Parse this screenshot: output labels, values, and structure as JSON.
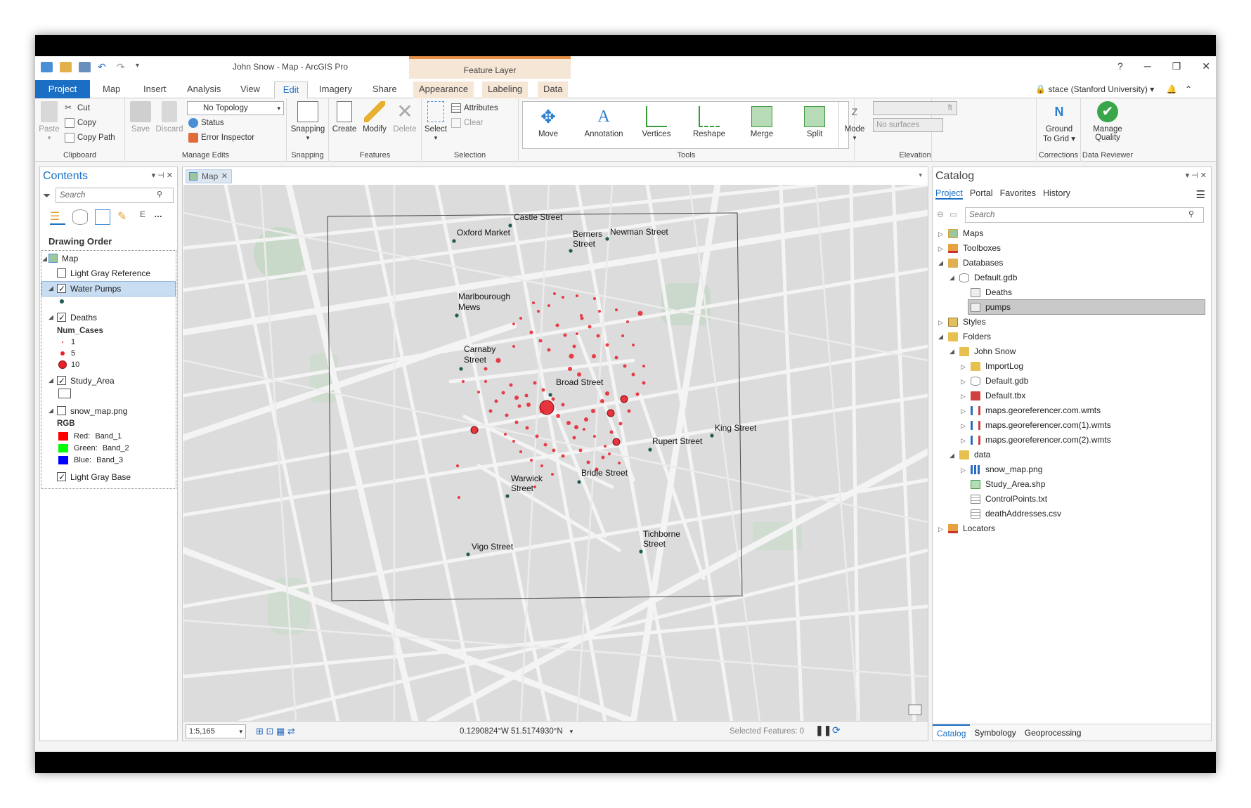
{
  "window": {
    "title": "John Snow - Map - ArcGIS Pro",
    "context_tab_group": "Feature Layer",
    "help": "?",
    "minimize": "─",
    "restore": "❐",
    "close": "✕",
    "user": "stace (Stanford University) ▾"
  },
  "tabs": [
    "Project",
    "Map",
    "Insert",
    "Analysis",
    "View",
    "Edit",
    "Imagery",
    "Share",
    "Appearance",
    "Labeling",
    "Data"
  ],
  "ribbon": {
    "clipboard": {
      "paste": "Paste",
      "cut": "Cut",
      "copy": "Copy",
      "copy_path": "Copy Path",
      "label": "Clipboard"
    },
    "manage_edits": {
      "save": "Save",
      "discard": "Discard",
      "topology": "No Topology",
      "status": "Status",
      "error_inspector": "Error Inspector",
      "label": "Manage Edits"
    },
    "snapping": {
      "snapping": "Snapping",
      "label": "Snapping"
    },
    "features": {
      "create": "Create",
      "modify": "Modify",
      "delete": "Delete",
      "label": "Features"
    },
    "selection": {
      "select": "Select",
      "attributes": "Attributes",
      "clear": "Clear",
      "label": "Selection"
    },
    "tools": {
      "items": [
        "Move",
        "Annotation",
        "Vertices",
        "Reshape",
        "Merge",
        "Split"
      ],
      "label": "Tools"
    },
    "elevation": {
      "mode": "Mode",
      "unit": "ft",
      "surfaces": "No surfaces",
      "label": "Elevation"
    },
    "corrections": {
      "ground_to_grid": "Ground",
      "ground_to_grid2": "To Grid ▾",
      "label": "Corrections"
    },
    "data_reviewer": {
      "manage_quality": "Manage",
      "manage_quality2": "Quality",
      "label": "Data Reviewer"
    }
  },
  "contents": {
    "title": "Contents",
    "search_placeholder": "Search",
    "drawing_order": "Drawing Order",
    "layers": {
      "map": "Map",
      "light_gray_reference": "Light Gray Reference",
      "water_pumps": "Water Pumps",
      "deaths": "Deaths",
      "num_cases": "Num_Cases",
      "case_1": "1",
      "case_5": "5",
      "case_10": "10",
      "study_area": "Study_Area",
      "snow_map": "snow_map.png",
      "rgb": "RGB",
      "red": "Red:",
      "red_band": "Band_1",
      "green": "Green:",
      "green_band": "Band_2",
      "blue": "Blue:",
      "blue_band": "Band_3",
      "light_gray_base": "Light Gray Base"
    }
  },
  "map": {
    "tab": "Map",
    "scale": "1:5,165",
    "coordinates": "0.1290824°W 51.5174930°N",
    "selected_features": "Selected Features: 0",
    "labels": {
      "castle": "Castle Street",
      "oxford": "Oxford Market",
      "berners1": "Berners",
      "berners2": "Street",
      "newman": "Newman Street",
      "marl1": "Marlbourough",
      "marl2": "Mews",
      "carnaby1": "Carnaby",
      "carnaby2": "Street",
      "broad": "Broad Street",
      "king": "King Street",
      "rupert": "Rupert Street",
      "bridle": "Bridle Street",
      "warwick1": "Warwick",
      "warwick2": "Street",
      "tich1": "Tichborne",
      "tich2": "Street",
      "vigo": "Vigo Street"
    }
  },
  "catalog": {
    "title": "Catalog",
    "tabs": [
      "Project",
      "Portal",
      "Favorites",
      "History"
    ],
    "search_placeholder": "Search",
    "items": {
      "maps": "Maps",
      "toolboxes": "Toolboxes",
      "databases": "Databases",
      "default_gdb": "Default.gdb",
      "deaths": "Deaths",
      "pumps": "pumps",
      "styles": "Styles",
      "folders": "Folders",
      "john_snow": "John Snow",
      "importlog": "ImportLog",
      "default_gdb2": "Default.gdb",
      "default_tbx": "Default.tbx",
      "wmts1": "maps.georeferencer.com.wmts",
      "wmts2": "maps.georeferencer.com(1).wmts",
      "wmts3": "maps.georeferencer.com(2).wmts",
      "data": "data",
      "snow_map": "snow_map.png",
      "study_area": "Study_Area.shp",
      "control_points": "ControlPoints.txt",
      "death_addresses": "deathAddresses.csv",
      "locators": "Locators"
    },
    "bottom_tabs": [
      "Catalog",
      "Symbology",
      "Geoprocessing"
    ]
  },
  "colors": {
    "accent": "#1a6fc4",
    "death_red": "#e8202a",
    "pump": "#1f5a55",
    "context_tab": "#e8934a"
  }
}
